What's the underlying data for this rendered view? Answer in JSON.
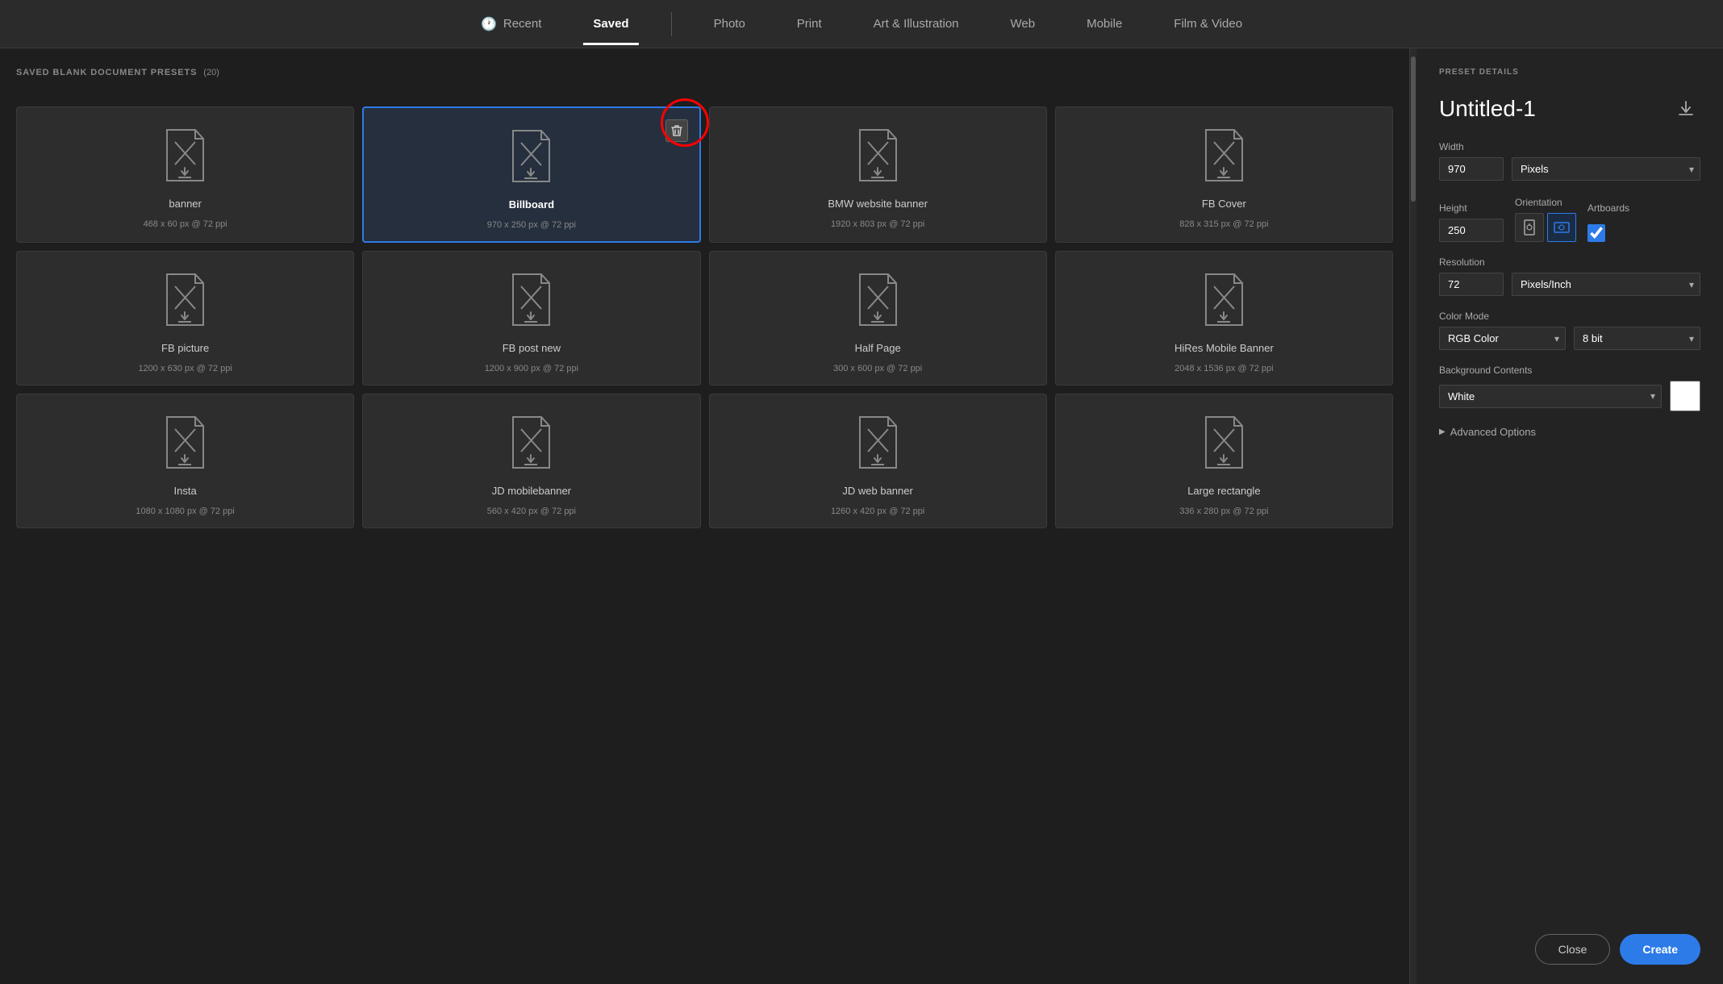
{
  "nav": {
    "items": [
      {
        "id": "recent",
        "label": "Recent",
        "icon": "clock"
      },
      {
        "id": "saved",
        "label": "Saved",
        "active": true
      },
      {
        "id": "photo",
        "label": "Photo"
      },
      {
        "id": "print",
        "label": "Print"
      },
      {
        "id": "art",
        "label": "Art & Illustration"
      },
      {
        "id": "web",
        "label": "Web"
      },
      {
        "id": "mobile",
        "label": "Mobile"
      },
      {
        "id": "film",
        "label": "Film & Video"
      }
    ]
  },
  "left": {
    "section_title": "SAVED BLANK DOCUMENT PRESETS",
    "preset_count": "(20)",
    "presets": [
      {
        "id": "banner",
        "name": "banner",
        "dims": "468 x 60 px @ 72 ppi",
        "selected": false
      },
      {
        "id": "billboard",
        "name": "Billboard",
        "dims": "970 x 250 px @ 72 ppi",
        "selected": true
      },
      {
        "id": "bmw",
        "name": "BMW website banner",
        "dims": "1920 x 803 px @ 72 ppi",
        "selected": false
      },
      {
        "id": "fbcover",
        "name": "FB Cover",
        "dims": "828 x 315 px @ 72 ppi",
        "selected": false
      },
      {
        "id": "fbpic",
        "name": "FB picture",
        "dims": "1200 x 630 px @ 72 ppi",
        "selected": false
      },
      {
        "id": "fbpost",
        "name": "FB post new",
        "dims": "1200 x 900 px @ 72 ppi",
        "selected": false
      },
      {
        "id": "halfpage",
        "name": "Half Page",
        "dims": "300 x 600 px @ 72 ppi",
        "selected": false
      },
      {
        "id": "hiresmobile",
        "name": "HiRes Mobile Banner",
        "dims": "2048 x 1536 px @ 72 ppi",
        "selected": false
      },
      {
        "id": "insta",
        "name": "Insta",
        "dims": "1080 x 1080 px @ 72 ppi",
        "selected": false
      },
      {
        "id": "jdmobile",
        "name": "JD mobilebanner",
        "dims": "560 x 420 px @ 72 ppi",
        "selected": false
      },
      {
        "id": "jdweb",
        "name": "JD web banner",
        "dims": "1260 x 420 px @ 72 ppi",
        "selected": false
      },
      {
        "id": "largerect",
        "name": "Large rectangle",
        "dims": "336 x 280 px @ 72 ppi",
        "selected": false
      }
    ]
  },
  "right": {
    "section_label": "PRESET DETAILS",
    "title": "Untitled-1",
    "width_label": "Width",
    "width_value": "970",
    "width_unit": "Pixels",
    "height_label": "Height",
    "height_value": "250",
    "orientation_label": "Orientation",
    "artboards_label": "Artboards",
    "resolution_label": "Resolution",
    "resolution_value": "72",
    "resolution_unit": "Pixels/Inch",
    "color_mode_label": "Color Mode",
    "color_mode_value": "RGB Color",
    "color_depth_value": "8 bit",
    "bg_contents_label": "Background Contents",
    "bg_value": "White",
    "advanced_label": "Advanced Options",
    "close_label": "Close",
    "create_label": "Create"
  }
}
